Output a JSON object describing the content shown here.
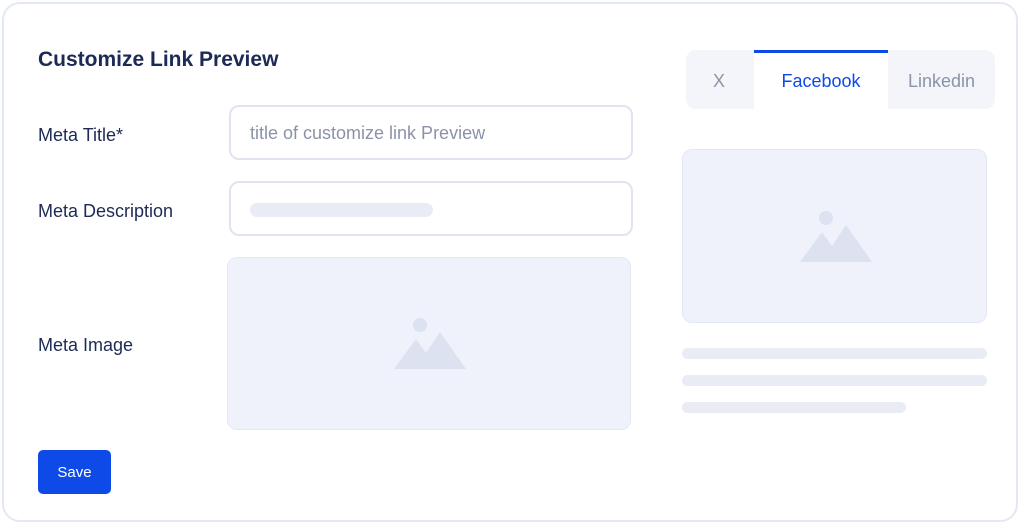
{
  "form": {
    "title": "Customize Link Preview",
    "meta_title_label": "Meta Title*",
    "meta_title_value": "title of customize link Preview",
    "meta_description_label": "Meta Description",
    "meta_image_label": "Meta Image",
    "save_label": "Save"
  },
  "preview": {
    "tabs": [
      {
        "label": "X",
        "active": false
      },
      {
        "label": "Facebook",
        "active": true
      },
      {
        "label": "Linkedin",
        "active": false
      }
    ]
  },
  "colors": {
    "accent": "#0d4ae8",
    "heading": "#1c2a55",
    "muted": "#8a93a8",
    "placeholder_fill": "#eff2fb"
  },
  "icons": {
    "image_placeholder": "image-icon"
  }
}
